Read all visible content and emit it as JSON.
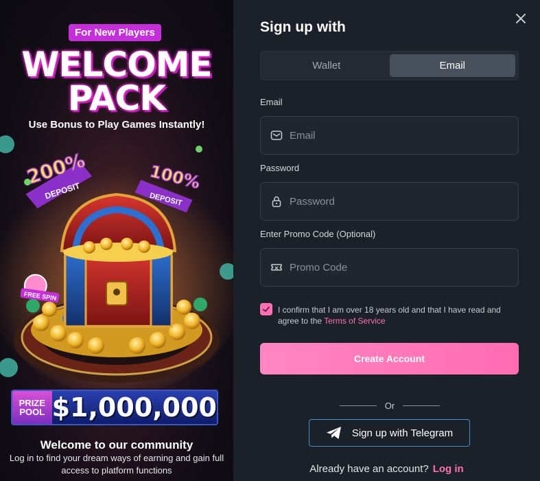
{
  "promo": {
    "badge": "For New Players",
    "title_line1": "WELCOME",
    "title_line2": "PACK",
    "subtitle": "Use Bonus to Play Games Instantly!",
    "bonus_200_pct": "200%",
    "bonus_200_label": "DEPOSIT",
    "bonus_100_pct": "100%",
    "bonus_100_label": "DEPOSIT",
    "free_spin_label": "FREE SPIN",
    "prize_label_line1": "PRIZE",
    "prize_label_line2": "POOL",
    "prize_amount": "$1,000,000",
    "community_title": "Welcome to our community",
    "community_text": "Log in to find your dream ways of earning and gain full access to platform functions"
  },
  "form": {
    "title": "Sign up with",
    "tabs": [
      {
        "label": "Wallet",
        "active": false
      },
      {
        "label": "Email",
        "active": true
      }
    ],
    "email_label": "Email",
    "email_placeholder": "Email",
    "password_label": "Password",
    "password_placeholder": "Password",
    "promo_label": "Enter Promo Code (Optional)",
    "promo_placeholder": "Promo Code",
    "consent_text": "I confirm that I am over 18 years old and that I have read and agree to the ",
    "terms_link": "Terms of Service",
    "consent_checked": true,
    "create_button": "Create Account",
    "divider_text": "Or",
    "telegram_button": "Sign up with Telegram",
    "login_prompt": "Already have an account?",
    "login_link": "Log in"
  },
  "colors": {
    "accent_pink": "#ff6fb3",
    "panel_bg": "#1b2129",
    "badge_purple": "#c52fd9",
    "telegram_border": "#4a8fd4"
  },
  "icons": [
    "close-icon",
    "envelope-icon",
    "lock-icon",
    "ticket-icon",
    "check-icon",
    "telegram-icon"
  ]
}
